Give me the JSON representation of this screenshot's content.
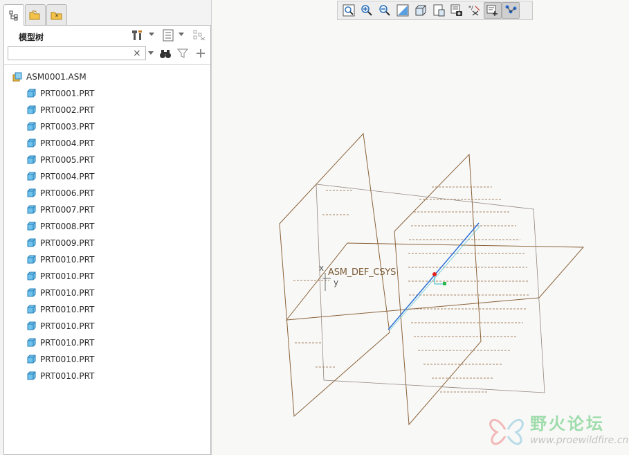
{
  "model_tree": {
    "title": "模型树",
    "search_value": "",
    "search_clear": "×",
    "items": [
      {
        "label": "ASM0001.ASM",
        "type": "assembly"
      },
      {
        "label": "PRT0001.PRT",
        "type": "part"
      },
      {
        "label": "PRT0002.PRT",
        "type": "part"
      },
      {
        "label": "PRT0003.PRT",
        "type": "part"
      },
      {
        "label": "PRT0004.PRT",
        "type": "part"
      },
      {
        "label": "PRT0005.PRT",
        "type": "part"
      },
      {
        "label": "PRT0004.PRT",
        "type": "part"
      },
      {
        "label": "PRT0006.PRT",
        "type": "part"
      },
      {
        "label": "PRT0007.PRT",
        "type": "part"
      },
      {
        "label": "PRT0008.PRT",
        "type": "part"
      },
      {
        "label": "PRT0009.PRT",
        "type": "part"
      },
      {
        "label": "PRT0010.PRT",
        "type": "part"
      },
      {
        "label": "PRT0010.PRT",
        "type": "part"
      },
      {
        "label": "PRT0010.PRT",
        "type": "part"
      },
      {
        "label": "PRT0010.PRT",
        "type": "part"
      },
      {
        "label": "PRT0010.PRT",
        "type": "part"
      },
      {
        "label": "PRT0010.PRT",
        "type": "part"
      },
      {
        "label": "PRT0010.PRT",
        "type": "part"
      },
      {
        "label": "PRT0010.PRT",
        "type": "part"
      }
    ]
  },
  "panel_tabs": [
    "model-tree-tab-icon",
    "folder-browser-tab-icon",
    "favorites-tab-icon"
  ],
  "graphics_toolbar": [
    {
      "name": "refit-icon"
    },
    {
      "name": "zoom-in-icon"
    },
    {
      "name": "zoom-out-icon"
    },
    {
      "name": "repaint-icon"
    },
    {
      "name": "display-style-icon"
    },
    {
      "name": "saved-orientations-icon"
    },
    {
      "name": "view-manager-icon"
    },
    {
      "name": "datum-display-filters-icon"
    },
    {
      "name": "spin-center-icon",
      "active": true
    },
    {
      "name": "annotation-display-icon",
      "active": true
    }
  ],
  "viewport": {
    "csys_label": "ASM_DEF_CSYS",
    "axis_x": "x",
    "axis_y": "y"
  },
  "watermark": {
    "text_cn": "野火论坛",
    "url": "www.proewildfire.cn"
  },
  "colors": {
    "datum_plane": "#8a6238",
    "axis_line": "#2a6fd6",
    "accent_green": "#9fdcab"
  }
}
